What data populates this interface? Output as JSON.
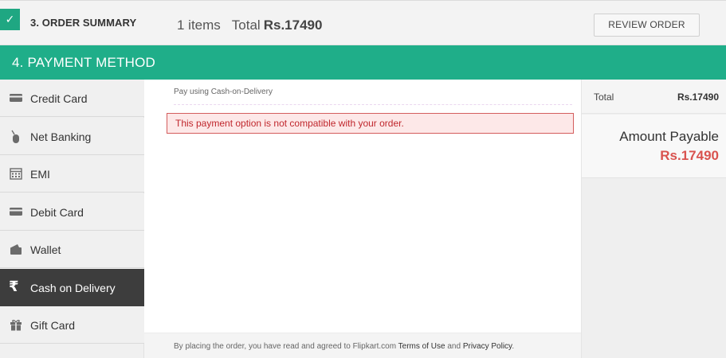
{
  "order_summary": {
    "check_icon": "✓",
    "step_title": "3. ORDER SUMMARY",
    "items_text": "1 items",
    "total_label": "Total",
    "total_value": "Rs.17490",
    "review_button": "REVIEW ORDER"
  },
  "payment": {
    "header_title": "4. PAYMENT METHOD",
    "methods": [
      {
        "label": "Credit Card",
        "icon": "credit-card-icon"
      },
      {
        "label": "Net Banking",
        "icon": "mouse-icon"
      },
      {
        "label": "EMI",
        "icon": "calendar-icon"
      },
      {
        "label": "Debit Card",
        "icon": "debit-card-icon"
      },
      {
        "label": "Wallet",
        "icon": "wallet-icon"
      },
      {
        "label": "Cash on Delivery",
        "icon": "rupee-icon"
      },
      {
        "label": "Gift Card",
        "icon": "gift-icon"
      }
    ],
    "active_method": "Cash on Delivery"
  },
  "main": {
    "pay_using": "Pay using Cash-on-Delivery",
    "error_message": "This payment option is not compatible with your order.",
    "footer_prefix": "By placing the order, you have read and agreed to Flipkart.com ",
    "footer_terms": "Terms of Use",
    "footer_and": " and ",
    "footer_privacy": "Privacy Policy",
    "footer_suffix": "."
  },
  "price_panel": {
    "total_label": "Total",
    "total_value": "Rs.17490",
    "amount_payable_label": "Amount Payable",
    "amount_payable_value": "Rs.17490"
  },
  "colors": {
    "accent_green": "#1fae89",
    "active_dark": "#3d3d3d",
    "error_red": "#c0272d",
    "amount_red": "#d9534f"
  }
}
